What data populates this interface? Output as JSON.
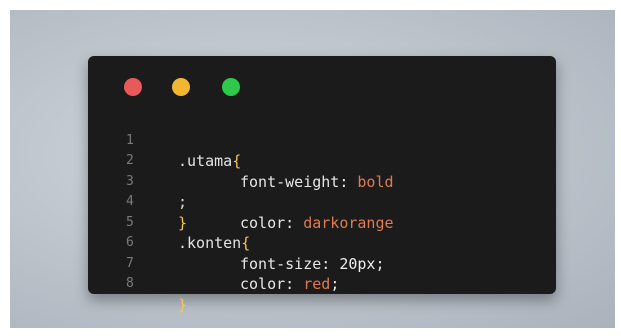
{
  "window": {
    "traffic_lights": [
      {
        "name": "close",
        "color": "#e85a5a"
      },
      {
        "name": "minimize",
        "color": "#f2b630"
      },
      {
        "name": "maximize",
        "color": "#2ec84a"
      }
    ]
  },
  "code": {
    "line_numbers": [
      "1",
      "2",
      "3",
      "4",
      "5",
      "6",
      "7",
      "8"
    ],
    "line1": {
      "selector": ".utama",
      "brace": "{"
    },
    "line2": {
      "property": "font-weight",
      "colon": ":",
      "value": "bold"
    },
    "line3": {
      "marker": ";",
      "property": "color",
      "colon": ":",
      "value": "darkorange"
    },
    "line4": {
      "brace": "}"
    },
    "line5": {
      "selector": ".konten",
      "brace": "{"
    },
    "line6": {
      "property": "font-size",
      "colon": ":",
      "value": "20px",
      "semicolon": ";"
    },
    "line7": {
      "property": "color",
      "colon": ":",
      "value": "red",
      "semicolon": ";"
    },
    "line8": {
      "brace": "}"
    }
  }
}
